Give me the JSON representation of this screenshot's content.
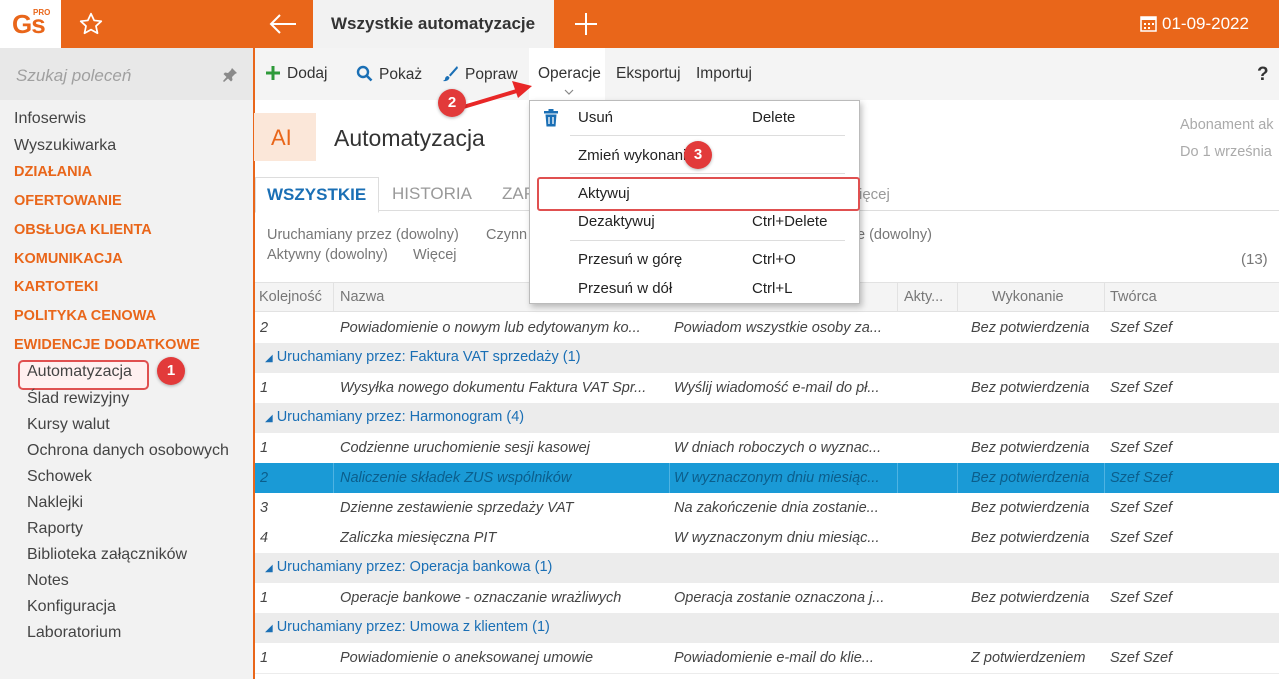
{
  "topbar": {
    "logo_text": "Gs",
    "logo_sup": "PRO",
    "active_tab": "Wszystkie automatyzacje",
    "date": "01-09-2022",
    "accent": "#e9661a"
  },
  "sidebar": {
    "search_placeholder": "Szukaj poleceń",
    "items": [
      {
        "label": "Infoserwis",
        "kind": "plain"
      },
      {
        "label": "Wyszukiwarka",
        "kind": "plain"
      },
      {
        "label": "DZIAŁANIA",
        "kind": "category"
      },
      {
        "label": "OFERTOWANIE",
        "kind": "category"
      },
      {
        "label": "OBSŁUGA KLIENTA",
        "kind": "category"
      },
      {
        "label": "KOMUNIKACJA",
        "kind": "category"
      },
      {
        "label": "KARTOTEKI",
        "kind": "category"
      },
      {
        "label": "POLITYKA CENOWA",
        "kind": "category"
      },
      {
        "label": "EWIDENCJE DODATKOWE",
        "kind": "category"
      },
      {
        "label": "Automatyzacja",
        "kind": "sub",
        "selected": true
      },
      {
        "label": "Ślad rewizyjny",
        "kind": "sub"
      },
      {
        "label": "Kursy walut",
        "kind": "sub"
      },
      {
        "label": "Ochrona danych osobowych",
        "kind": "sub"
      },
      {
        "label": "Schowek",
        "kind": "sub"
      },
      {
        "label": "Naklejki",
        "kind": "sub"
      },
      {
        "label": "Raporty",
        "kind": "sub"
      },
      {
        "label": "Biblioteka załączników",
        "kind": "sub"
      },
      {
        "label": "Notes",
        "kind": "sub"
      },
      {
        "label": "Konfiguracja",
        "kind": "sub"
      },
      {
        "label": "Laboratorium",
        "kind": "sub"
      }
    ]
  },
  "toolbar": {
    "add": "Dodaj",
    "show": "Pokaż",
    "edit": "Popraw",
    "operations": "Operacje",
    "export": "Eksportuj",
    "import": "Importuj",
    "help": "?"
  },
  "header": {
    "icon_text": "AI",
    "title": "Automatyzacja",
    "subscription_line1": "Abonament ak",
    "subscription_line2": "Do 1 września"
  },
  "tabs": {
    "all": "WSZYSTKIE",
    "history": "HISTORIA",
    "third_partial": "ZAP",
    "more_partial": "ięcej"
  },
  "filters": {
    "run_by": "Uruchamiany przez (dowolny)",
    "activity_partial": "Czynn",
    "other_partial": "e (dowolny)",
    "active": "Aktywny (dowolny)",
    "more": "Więcej",
    "count": "(13)"
  },
  "grid": {
    "columns": [
      "Kolejność",
      "Nazwa",
      "Akty...",
      "Wykonanie",
      "Twórca"
    ],
    "rows": [
      {
        "type": "data",
        "order": "2",
        "name": "Powiadomienie o nowym lub edytowanym ko...",
        "action": "Powiadom wszystkie osoby za...",
        "exec": "Bez potwierdzenia",
        "author": "Szef Szef"
      },
      {
        "type": "group",
        "prefix": "Uruchamiany przez:",
        "label": "Faktura VAT sprzedaży",
        "count": "(1)"
      },
      {
        "type": "data",
        "order": "1",
        "name": "Wysyłka nowego dokumentu Faktura VAT Spr...",
        "action": "Wyślij wiadomość e-mail do pł...",
        "exec": "Bez potwierdzenia",
        "author": "Szef Szef"
      },
      {
        "type": "group",
        "prefix": "Uruchamiany przez:",
        "label": "Harmonogram",
        "count": "(4)"
      },
      {
        "type": "data",
        "order": "1",
        "name": "Codzienne uruchomienie sesji kasowej",
        "action": "W dniach roboczych o wyznac...",
        "exec": "Bez potwierdzenia",
        "author": "Szef Szef"
      },
      {
        "type": "data",
        "order": "2",
        "name": "Naliczenie składek ZUS wspólników",
        "action": "W wyznaczonym dniu miesiąc...",
        "exec": "Bez potwierdzenia",
        "author": "Szef Szef",
        "selected": true
      },
      {
        "type": "data",
        "order": "3",
        "name": "Dzienne zestawienie sprzedaży VAT",
        "action": "Na zakończenie dnia zostanie...",
        "exec": "Bez potwierdzenia",
        "author": "Szef Szef"
      },
      {
        "type": "data",
        "order": "4",
        "name": "Zaliczka miesięczna PIT",
        "action": "W wyznaczonym dniu miesiąc...",
        "exec": "Bez potwierdzenia",
        "author": "Szef Szef"
      },
      {
        "type": "group",
        "prefix": "Uruchamiany przez:",
        "label": "Operacja bankowa",
        "count": "(1)"
      },
      {
        "type": "data",
        "order": "1",
        "name": "Operacje bankowe - oznaczanie wrażliwych",
        "action": "Operacja zostanie oznaczona j...",
        "exec": "Bez potwierdzenia",
        "author": "Szef Szef"
      },
      {
        "type": "group",
        "prefix": "Uruchamiany przez:",
        "label": "Umowa z klientem",
        "count": "(1)"
      },
      {
        "type": "data",
        "order": "1",
        "name": "Powiadomienie o aneksowanej umowie",
        "action": "Powiadomienie e-mail do klie...",
        "exec": "Z potwierdzeniem",
        "author": "Szef Szef"
      }
    ]
  },
  "menu": {
    "items": [
      {
        "label": "Usuń",
        "shortcut": "Delete"
      },
      {
        "label": "Zmień wykonanie",
        "shortcut": ""
      },
      {
        "label": "Aktywuj",
        "shortcut": ""
      },
      {
        "label": "Dezaktywuj",
        "shortcut": "Ctrl+Delete"
      },
      {
        "label": "Przesuń w górę",
        "shortcut": "Ctrl+O"
      },
      {
        "label": "Przesuń w dół",
        "shortcut": "Ctrl+L"
      }
    ]
  },
  "annotations": {
    "step1": "1",
    "step2": "2",
    "step3": "3"
  }
}
